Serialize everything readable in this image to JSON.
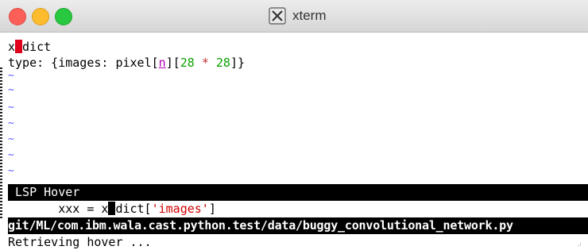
{
  "window": {
    "title": "xterm",
    "icon": "x-window-icon"
  },
  "terminal": {
    "line1": {
      "before": "x",
      "after": "dict"
    },
    "line2": {
      "prefix": "type: {images: pixel[",
      "param": "n",
      "mid": "][",
      "num1": "28",
      "op": " * ",
      "num2": "28",
      "suffix": "]}"
    },
    "tilde": "~",
    "hover_title": " LSP Hover",
    "hover_code": {
      "indent": "       xxx = x",
      "rest": "dict[",
      "string": "'images'",
      "close": "]"
    },
    "path": "git/ML/com.ibm.wala.cast.python.test/data/buggy_convolutional_network.py",
    "status": "Retrieving hover ..."
  }
}
